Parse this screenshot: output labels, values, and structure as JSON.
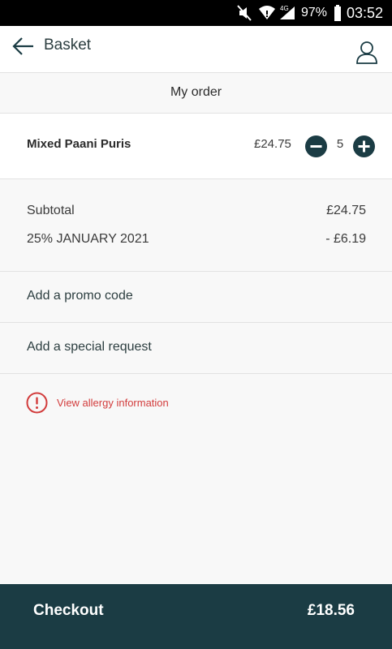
{
  "status_bar": {
    "battery_percent": "97%",
    "time": "03:52",
    "network_label": "4G",
    "icons": [
      "mute-icon",
      "wifi-icon",
      "signal-icon",
      "battery-icon"
    ]
  },
  "header": {
    "title": "Basket",
    "back_icon": "arrow-left-icon",
    "account_icon": "user-icon"
  },
  "order": {
    "section_title": "My order",
    "items": [
      {
        "name": "Mixed Paani Puris",
        "price": "£24.75",
        "quantity": "5"
      }
    ]
  },
  "summary": {
    "subtotal_label": "Subtotal",
    "subtotal_value": "£24.75",
    "discount_label": "25% JANUARY 2021",
    "discount_value": "- £6.19"
  },
  "actions": {
    "promo_label": "Add a promo code",
    "special_request_label": "Add a special request",
    "allergy_label": "View allergy information"
  },
  "checkout": {
    "label": "Checkout",
    "total": "£18.56"
  },
  "colors": {
    "primary_dark": "#1b3c44",
    "accent_red": "#d23c3c",
    "background": "#f8f8f8"
  }
}
